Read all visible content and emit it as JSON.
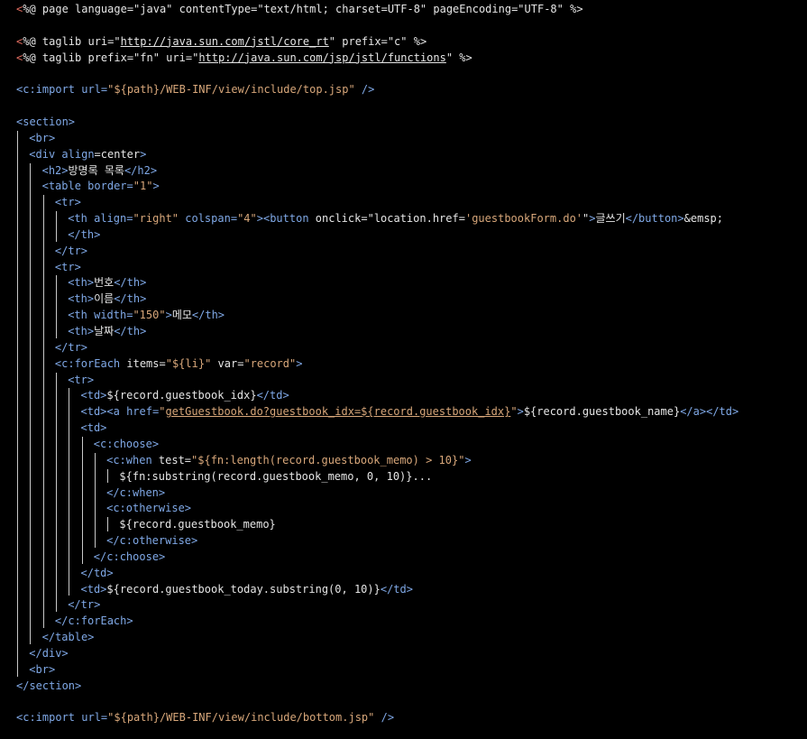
{
  "editor": {
    "colors": {
      "background": "#000000",
      "tag": "#7fa8e6",
      "string": "#d8a77a",
      "text": "#e6e6e6",
      "jsp_delimiter": "#e06c5f"
    },
    "lines": [
      {
        "indent": 0,
        "tokens": [
          {
            "t": "bracket",
            "v": "<"
          },
          {
            "t": "jsp",
            "v": "%@ page language=\"java\" contentType=\"text/html; charset=UTF-8\" pageEncoding=\"UTF-8\" %>"
          }
        ]
      },
      {
        "indent": 0,
        "tokens": []
      },
      {
        "indent": 0,
        "tokens": [
          {
            "t": "bracket",
            "v": "<"
          },
          {
            "t": "jsp",
            "v": "%@ taglib uri=\""
          },
          {
            "t": "link",
            "v": "http://java.sun.com/jstl/core_rt"
          },
          {
            "t": "jsp",
            "v": "\" prefix=\"c\" %>"
          }
        ]
      },
      {
        "indent": 0,
        "tokens": [
          {
            "t": "bracket",
            "v": "<"
          },
          {
            "t": "jsp",
            "v": "%@ taglib prefix=\"fn\" uri=\""
          },
          {
            "t": "link",
            "v": "http://java.sun.com/jsp/jstl/functions"
          },
          {
            "t": "jsp",
            "v": "\" %>"
          }
        ]
      },
      {
        "indent": 0,
        "tokens": []
      },
      {
        "indent": 0,
        "tokens": [
          {
            "t": "tag",
            "v": "<c:import "
          },
          {
            "t": "tag",
            "v": "url="
          },
          {
            "t": "str",
            "v": "\"${path}/WEB-INF/view/include/top.jsp\""
          },
          {
            "t": "tag",
            "v": " />"
          }
        ]
      },
      {
        "indent": 0,
        "tokens": []
      },
      {
        "indent": 0,
        "tokens": [
          {
            "t": "tag",
            "v": "<section>"
          }
        ]
      },
      {
        "indent": 1,
        "tokens": [
          {
            "t": "tag",
            "v": "<br>"
          }
        ]
      },
      {
        "indent": 1,
        "tokens": [
          {
            "t": "tag",
            "v": "<div "
          },
          {
            "t": "tag",
            "v": "align"
          },
          {
            "t": "plain",
            "v": "=center"
          },
          {
            "t": "tag",
            "v": ">"
          }
        ]
      },
      {
        "indent": 2,
        "tokens": [
          {
            "t": "tag",
            "v": "<h2>"
          },
          {
            "t": "plain",
            "v": "방명록 목록"
          },
          {
            "t": "tag",
            "v": "</h2>"
          }
        ]
      },
      {
        "indent": 2,
        "tokens": [
          {
            "t": "tag",
            "v": "<table "
          },
          {
            "t": "tag",
            "v": "border="
          },
          {
            "t": "str",
            "v": "\"1\""
          },
          {
            "t": "tag",
            "v": ">"
          }
        ]
      },
      {
        "indent": 3,
        "tokens": [
          {
            "t": "tag",
            "v": "<tr>"
          }
        ]
      },
      {
        "indent": 4,
        "tokens": [
          {
            "t": "tag",
            "v": "<th "
          },
          {
            "t": "tag",
            "v": "align="
          },
          {
            "t": "str",
            "v": "\"right\""
          },
          {
            "t": "tag",
            "v": " colspan="
          },
          {
            "t": "str",
            "v": "\"4\""
          },
          {
            "t": "tag",
            "v": "><button "
          },
          {
            "t": "plain",
            "v": "onclick=\""
          },
          {
            "t": "plain",
            "v": "location.href="
          },
          {
            "t": "str",
            "v": "'guestbookForm.do'"
          },
          {
            "t": "plain",
            "v": "\""
          },
          {
            "t": "tag",
            "v": ">"
          },
          {
            "t": "plain",
            "v": "글쓰기"
          },
          {
            "t": "tag",
            "v": "</button>"
          },
          {
            "t": "plain",
            "v": "&emsp;"
          }
        ]
      },
      {
        "indent": 4,
        "tokens": [
          {
            "t": "tag",
            "v": "</th>"
          }
        ]
      },
      {
        "indent": 3,
        "tokens": [
          {
            "t": "tag",
            "v": "</tr>"
          }
        ]
      },
      {
        "indent": 3,
        "tokens": [
          {
            "t": "tag",
            "v": "<tr>"
          }
        ]
      },
      {
        "indent": 4,
        "tokens": [
          {
            "t": "tag",
            "v": "<th>"
          },
          {
            "t": "plain",
            "v": "번호"
          },
          {
            "t": "tag",
            "v": "</th>"
          }
        ]
      },
      {
        "indent": 4,
        "tokens": [
          {
            "t": "tag",
            "v": "<th>"
          },
          {
            "t": "plain",
            "v": "이름"
          },
          {
            "t": "tag",
            "v": "</th>"
          }
        ]
      },
      {
        "indent": 4,
        "tokens": [
          {
            "t": "tag",
            "v": "<th "
          },
          {
            "t": "tag",
            "v": "width="
          },
          {
            "t": "str",
            "v": "\"150\""
          },
          {
            "t": "tag",
            "v": ">"
          },
          {
            "t": "plain",
            "v": "메모"
          },
          {
            "t": "tag",
            "v": "</th>"
          }
        ]
      },
      {
        "indent": 4,
        "tokens": [
          {
            "t": "tag",
            "v": "<th>"
          },
          {
            "t": "plain",
            "v": "날짜"
          },
          {
            "t": "tag",
            "v": "</th>"
          }
        ]
      },
      {
        "indent": 3,
        "tokens": [
          {
            "t": "tag",
            "v": "</tr>"
          }
        ]
      },
      {
        "indent": 3,
        "tokens": [
          {
            "t": "tag",
            "v": "<c:forEach "
          },
          {
            "t": "plain",
            "v": "items="
          },
          {
            "t": "str",
            "v": "\"${li}\""
          },
          {
            "t": "plain",
            "v": " var="
          },
          {
            "t": "str",
            "v": "\"record\""
          },
          {
            "t": "tag",
            "v": ">"
          }
        ]
      },
      {
        "indent": 4,
        "tokens": [
          {
            "t": "tag",
            "v": "<tr>"
          }
        ]
      },
      {
        "indent": 5,
        "tokens": [
          {
            "t": "tag",
            "v": "<td>"
          },
          {
            "t": "plain",
            "v": "${record.guestbook_idx}"
          },
          {
            "t": "tag",
            "v": "</td>"
          }
        ]
      },
      {
        "indent": 5,
        "tokens": [
          {
            "t": "tag",
            "v": "<td><a "
          },
          {
            "t": "tag",
            "v": "href="
          },
          {
            "t": "str",
            "v": "\""
          },
          {
            "t": "strlink",
            "v": "getGuestbook.do?guestbook_idx=${record.guestbook_idx}"
          },
          {
            "t": "str",
            "v": "\""
          },
          {
            "t": "tag",
            "v": ">"
          },
          {
            "t": "plain",
            "v": "${record.guestbook_name}"
          },
          {
            "t": "tag",
            "v": "</a></td>"
          }
        ]
      },
      {
        "indent": 5,
        "tokens": [
          {
            "t": "tag",
            "v": "<td>"
          }
        ]
      },
      {
        "indent": 6,
        "tokens": [
          {
            "t": "tag",
            "v": "<c:choose>"
          }
        ]
      },
      {
        "indent": 7,
        "tokens": [
          {
            "t": "tag",
            "v": "<c:when "
          },
          {
            "t": "plain",
            "v": "test="
          },
          {
            "t": "str",
            "v": "\"${fn:length(record.guestbook_memo) > 10}\""
          },
          {
            "t": "tag",
            "v": ">"
          }
        ]
      },
      {
        "indent": 8,
        "tokens": [
          {
            "t": "plain",
            "v": "${fn:substring(record.guestbook_memo, 0, 10)}..."
          }
        ]
      },
      {
        "indent": 7,
        "tokens": [
          {
            "t": "tag",
            "v": "</c:when>"
          }
        ]
      },
      {
        "indent": 7,
        "tokens": [
          {
            "t": "tag",
            "v": "<c:otherwise>"
          }
        ]
      },
      {
        "indent": 8,
        "tokens": [
          {
            "t": "plain",
            "v": "${record.guestbook_memo}"
          }
        ]
      },
      {
        "indent": 7,
        "tokens": [
          {
            "t": "tag",
            "v": "</c:otherwise>"
          }
        ]
      },
      {
        "indent": 6,
        "tokens": [
          {
            "t": "tag",
            "v": "</c:choose>"
          }
        ]
      },
      {
        "indent": 5,
        "tokens": [
          {
            "t": "tag",
            "v": "</td>"
          }
        ]
      },
      {
        "indent": 5,
        "tokens": [
          {
            "t": "tag",
            "v": "<td>"
          },
          {
            "t": "plain",
            "v": "${record.guestbook_today.substring(0, 10)}"
          },
          {
            "t": "tag",
            "v": "</td>"
          }
        ]
      },
      {
        "indent": 4,
        "tokens": [
          {
            "t": "tag",
            "v": "</tr>"
          }
        ]
      },
      {
        "indent": 3,
        "tokens": [
          {
            "t": "tag",
            "v": "</c:forEach>"
          }
        ]
      },
      {
        "indent": 2,
        "tokens": [
          {
            "t": "tag",
            "v": "</table>"
          }
        ]
      },
      {
        "indent": 1,
        "tokens": [
          {
            "t": "tag",
            "v": "</div>"
          }
        ]
      },
      {
        "indent": 1,
        "tokens": [
          {
            "t": "tag",
            "v": "<br>"
          }
        ]
      },
      {
        "indent": 0,
        "tokens": [
          {
            "t": "tag",
            "v": "</section>"
          }
        ]
      },
      {
        "indent": 0,
        "tokens": []
      },
      {
        "indent": 0,
        "tokens": [
          {
            "t": "tag",
            "v": "<c:import "
          },
          {
            "t": "tag",
            "v": "url="
          },
          {
            "t": "str",
            "v": "\"${path}/WEB-INF/view/include/bottom.jsp\""
          },
          {
            "t": "tag",
            "v": " />"
          }
        ]
      }
    ]
  }
}
